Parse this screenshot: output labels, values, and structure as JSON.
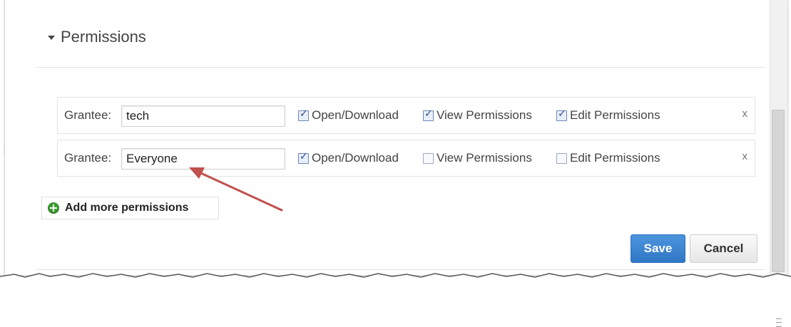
{
  "section": {
    "title": "Permissions"
  },
  "grantee_label": "Grantee:",
  "rows": [
    {
      "grantee": "tech",
      "open_download": {
        "label": "Open/Download",
        "checked": true
      },
      "view_permissions": {
        "label": "View Permissions",
        "checked": true
      },
      "edit_permissions": {
        "label": "Edit Permissions",
        "checked": true
      },
      "remove": "x"
    },
    {
      "grantee": "Everyone",
      "open_download": {
        "label": "Open/Download",
        "checked": true
      },
      "view_permissions": {
        "label": "View Permissions",
        "checked": false
      },
      "edit_permissions": {
        "label": "Edit Permissions",
        "checked": false
      },
      "remove": "x"
    }
  ],
  "add_button": {
    "label": "Add more permissions",
    "icon": "add-circle-icon"
  },
  "footer": {
    "save_label": "Save",
    "cancel_label": "Cancel"
  },
  "colors": {
    "save_button": "#2f77c6",
    "add_icon": "#3a9a2f",
    "arrow": "#c0504d"
  }
}
